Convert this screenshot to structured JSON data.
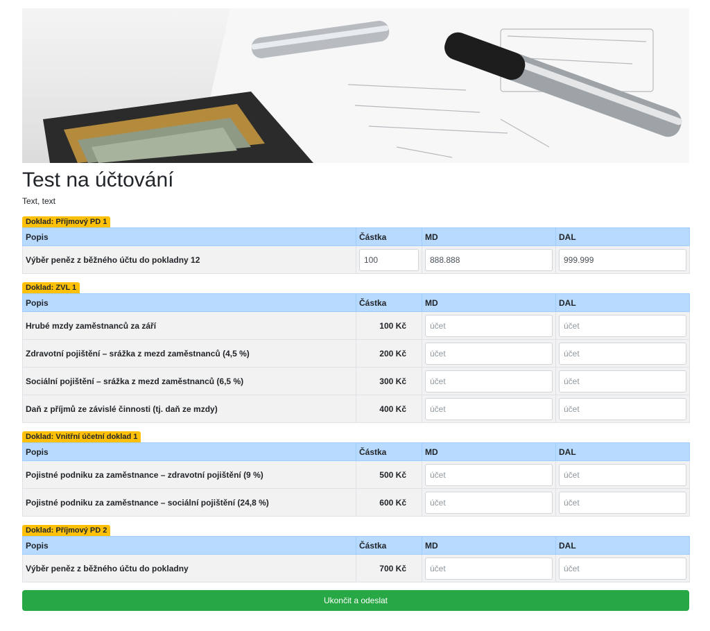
{
  "header": {
    "title": "Test na účtování",
    "subtitle": "Text, text"
  },
  "columns": {
    "popis": "Popis",
    "castka": "Částka",
    "md": "MD",
    "dal": "DAL"
  },
  "placeholder": "účet",
  "documents": [
    {
      "label": "Doklad: Příjmový PD 1",
      "rows": [
        {
          "popis": "Výběr peněz z běžného účtu do pokladny 12",
          "castka": "100",
          "md": "888.888",
          "dal": "999.999"
        }
      ]
    },
    {
      "label": "Doklad: ZVL 1",
      "rows": [
        {
          "popis": "Hrubé mzdy zaměstnanců za září",
          "castka": "100 Kč"
        },
        {
          "popis": "Zdravotní pojištění – srážka z mezd zaměstnanců (4,5 %)",
          "castka": "200 Kč"
        },
        {
          "popis": "Sociální pojištění – srážka z mezd zaměstnanců (6,5 %)",
          "castka": "300 Kč"
        },
        {
          "popis": "Daň z příjmů ze závislé činnosti (tj. daň ze mzdy)",
          "castka": "400 Kč"
        }
      ]
    },
    {
      "label": "Doklad: Vnitřní účetní doklad 1",
      "rows": [
        {
          "popis": "Pojistné podniku za zaměstnance – zdravotní pojištění (9 %)",
          "castka": "500 Kč"
        },
        {
          "popis": "Pojistné podniku za zaměstnance – sociální pojištění (24,8 %)",
          "castka": "600 Kč"
        }
      ]
    },
    {
      "label": "Doklad: Příjmový PD 2",
      "rows": [
        {
          "popis": "Výběr peněz z běžného účtu do pokladny",
          "castka": "700 Kč"
        }
      ]
    }
  ],
  "submit": {
    "label": "Ukončit a odeslat"
  },
  "colors": {
    "badge": "#ffc107",
    "header_row": "#b8daff",
    "submit": "#28a745"
  }
}
